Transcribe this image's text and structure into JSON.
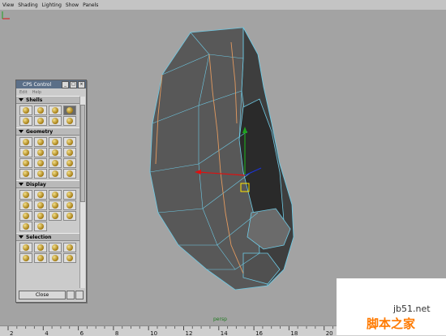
{
  "menubar": {
    "items": [
      "View",
      "Shading",
      "Lighting",
      "Show",
      "Panels"
    ]
  },
  "viewport": {
    "camera_label": "persp",
    "mesh_color": "#5c5c5c",
    "edge_color": "#6ecbe6",
    "seam_color": "#e39a5f"
  },
  "cps_panel": {
    "title": "CPS Control",
    "menu": [
      "Edit",
      "Help"
    ],
    "sections": [
      {
        "label": "Shells",
        "rows": 2
      },
      {
        "label": "Geometry",
        "rows": 4
      },
      {
        "label": "Display",
        "rows": 4
      },
      {
        "label": "Selection",
        "rows": 2
      }
    ],
    "close_label": "Close"
  },
  "timeline": {
    "ticks": [
      "2",
      "4",
      "6",
      "8",
      "10",
      "12",
      "14",
      "16",
      "18",
      "20"
    ]
  },
  "watermark": {
    "url": "jb51.net",
    "site_name": "脚本之家"
  }
}
